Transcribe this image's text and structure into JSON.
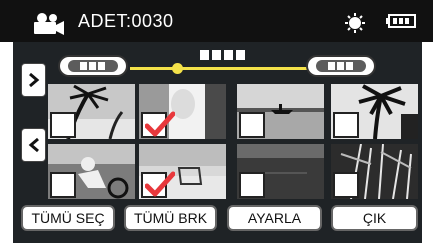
{
  "header": {
    "count_text": "ADET:0030",
    "icons": {
      "mode": "video-camera-icon",
      "status": "sun-icon",
      "battery": "battery-icon"
    }
  },
  "navigation": {
    "prev_pill_icon": "previous-pill-icon",
    "next_pill_icon": "next-pill-icon",
    "next_arrow": "›",
    "prev_arrow": "‹",
    "slider_position": 0.23
  },
  "thumbnails": [
    {
      "scene": "palm-sunset",
      "selected": false
    },
    {
      "scene": "person-portrait",
      "selected": true
    },
    {
      "scene": "boat-on-lake",
      "selected": false
    },
    {
      "scene": "palm-silhouette",
      "selected": false
    },
    {
      "scene": "cyclist",
      "selected": false
    },
    {
      "scene": "beach-chair",
      "selected": true
    },
    {
      "scene": "dark-water",
      "selected": false
    },
    {
      "scene": "bamboo-grass",
      "selected": false
    }
  ],
  "buttons": {
    "select_all": "TÜMÜ SEÇ",
    "deselect_all": "TÜMÜ BRK",
    "set": "AYARLA",
    "exit": "ÇIK"
  },
  "colors": {
    "header_bg": "#111111",
    "panel_bg": "#1f2326",
    "slider": "#f4e24a",
    "check": "#e8383c"
  }
}
